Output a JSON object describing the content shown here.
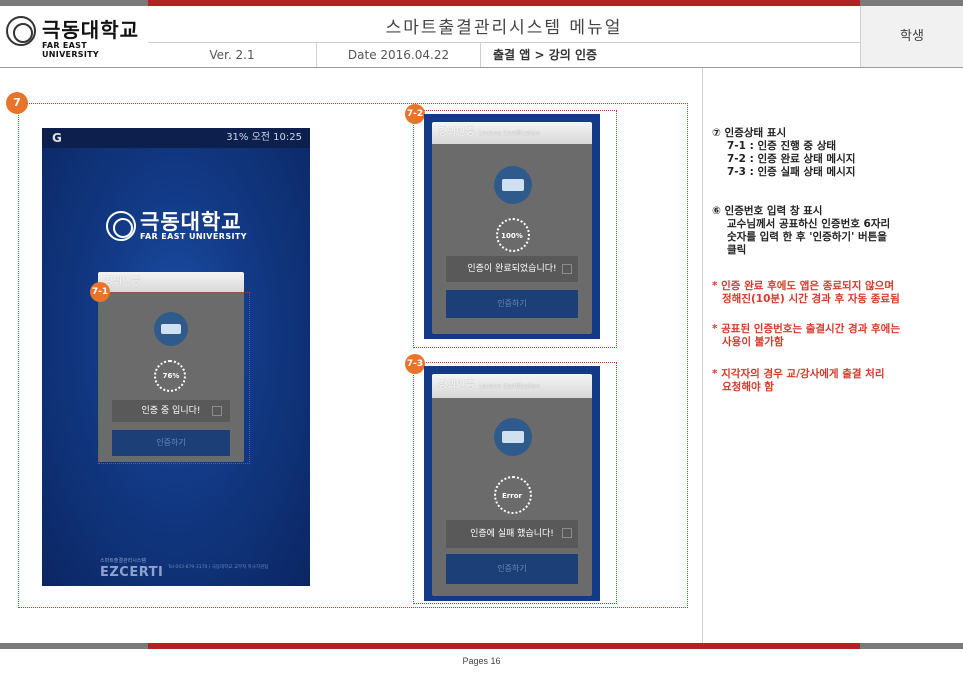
{
  "header": {
    "logo_kr": "극동대학교",
    "logo_en": "FAR EAST UNIVERSITY",
    "title": "스마트출결관리시스템 메뉴얼",
    "version": "Ver. 2.1",
    "date": "Date 2016.04.22",
    "path": "출결 앱  > 강의 인증",
    "role": "학생"
  },
  "badges": {
    "main": "7",
    "b71": "7-1",
    "b72": "7-2",
    "b73": "7-3"
  },
  "phone1": {
    "status_left": "G",
    "status_right": "31%  오전 10:25",
    "logo_kr": "극동대학교",
    "logo_en": "FAR EAST UNIVERSITY",
    "dialog_head": "강의인증",
    "dialog_msg": "인증 중 입니다!",
    "spinner": "76%",
    "button": "인증하기",
    "footer_small": "스마트출결관리시스템",
    "footer_brand": "EZCERTI",
    "footer_info": "Tel 043-879-3170 / 극동대학교 교무처 학사지원팀"
  },
  "phone2": {
    "dialog_head": "강의인증",
    "dialog_sub": "Lecture Certification",
    "spinner": "100%",
    "dialog_msg": "인증이 완료되었습니다!",
    "button": "인증하기"
  },
  "phone3": {
    "dialog_head": "강의인증",
    "dialog_sub": "Lecture Certification",
    "spinner": "Error",
    "dialog_msg": "인증에 실패 했습니다!",
    "button": "인증하기"
  },
  "right_panel": {
    "s7_title": "⑦ 인증상태 표시",
    "s7_1": "7-1 : 인증 진행 중 상태",
    "s7_2": "7-2 : 인증 완료 상태 메시지",
    "s7_3": "7-3 : 인증 실패 상태 메시지",
    "s6_title": "⑥ 인증번호 입력 창 표시",
    "s6_l1": "교수님께서 공표하신 인증번호 6자리",
    "s6_l2": "숫자를 입력 한 후 '인증하기' 버튼을",
    "s6_l3": "클릭",
    "n1_l1": "* 인증 완료 후에도 앱은 종료되지 않으며",
    "n1_l2": "정해진(10분) 시간 경과 후 자동 종료됨",
    "n2_l1": "* 공표된 인증번호는 출결시간 경과 후에는",
    "n2_l2": "사용이 불가함",
    "n3_l1": "* 지각자의 경우 교/강사에게 출결 처리",
    "n3_l2": "요청해야 함"
  },
  "footer": {
    "page_label": "Pages   16"
  }
}
